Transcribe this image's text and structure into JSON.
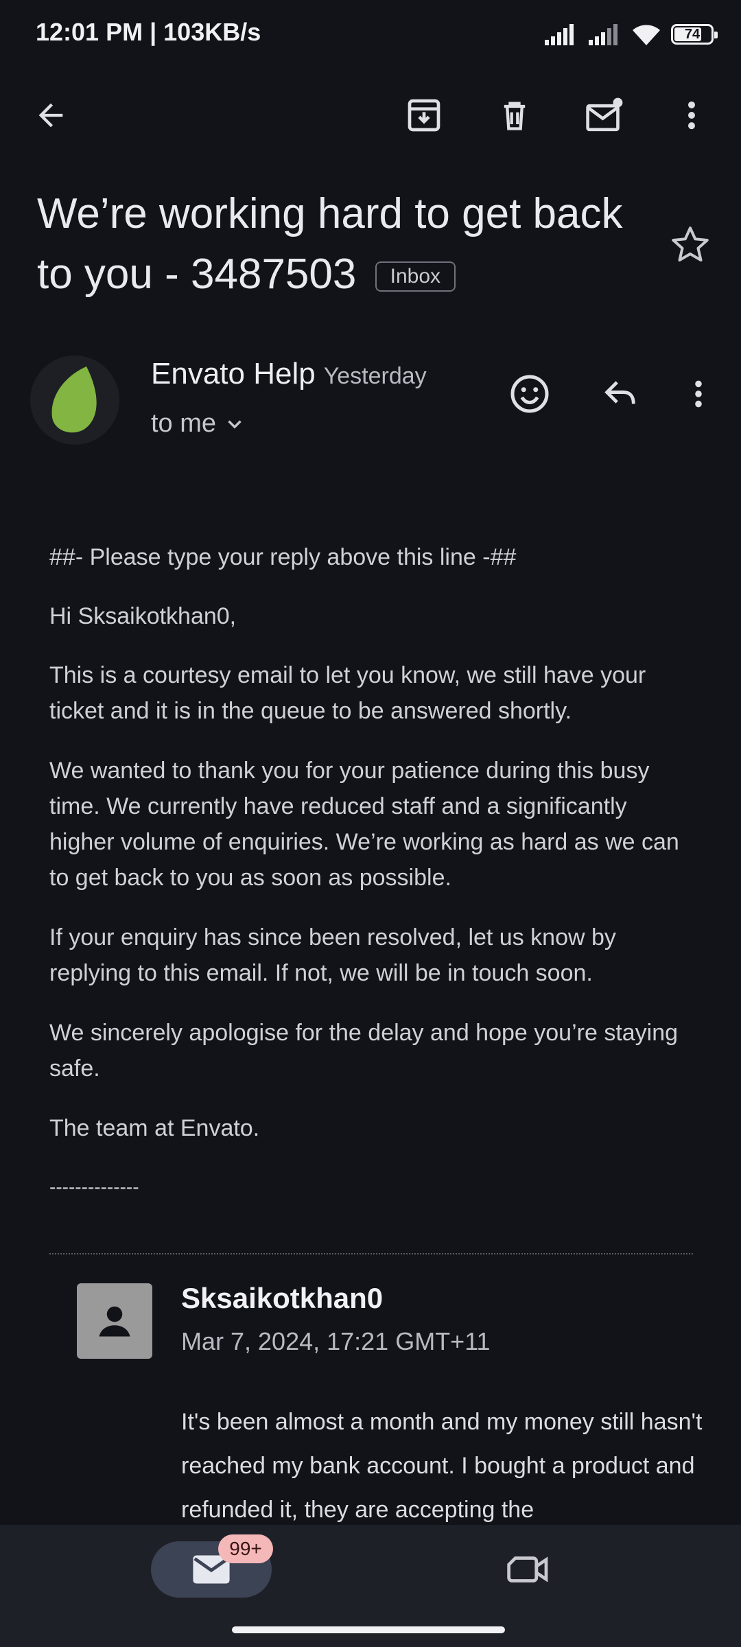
{
  "status_bar": {
    "time": "12:01 PM | 103KB/s",
    "battery": "74"
  },
  "toolbar": {
    "icons": [
      "back-arrow-icon",
      "archive-icon",
      "delete-icon",
      "mark-unread-icon",
      "more-vert-icon"
    ]
  },
  "email": {
    "subject": "We’re working hard to get back to you - 3487503",
    "label_chip": "Inbox",
    "sender": "Envato Help",
    "time": "Yesterday",
    "recipient": "to me",
    "body": [
      "##- Please type your reply above this line -##",
      "Hi Sksaikotkhan0,",
      "This is a courtesy email to let you know, we still have your ticket and it is in the queue to be answered shortly.",
      "We wanted to thank you for your patience during this busy time. We currently have reduced staff and a significantly higher volume of enquiries. We’re working as hard as we can to get back to you as soon as possible.",
      "If your enquiry has since been resolved, let us know by replying to this email. If not, we will be in touch soon.",
      "We sincerely apologise for the delay and hope you’re staying safe.",
      "The team at Envato.",
      "--------------"
    ]
  },
  "quoted": {
    "author": "Sksaikotkhan0",
    "date": "Mar 7, 2024, 17:21 GMT+11",
    "text": "It's been almost a month and my money still hasn't reached my bank account. I bought a product and refunded it, they are accepting the"
  },
  "bottom_nav": {
    "mail_badge": "99+"
  },
  "colors": {
    "background": "#121319",
    "envato_green": "#82b541",
    "nav_active": "#3c4354",
    "badge": "#f5b8b8"
  }
}
